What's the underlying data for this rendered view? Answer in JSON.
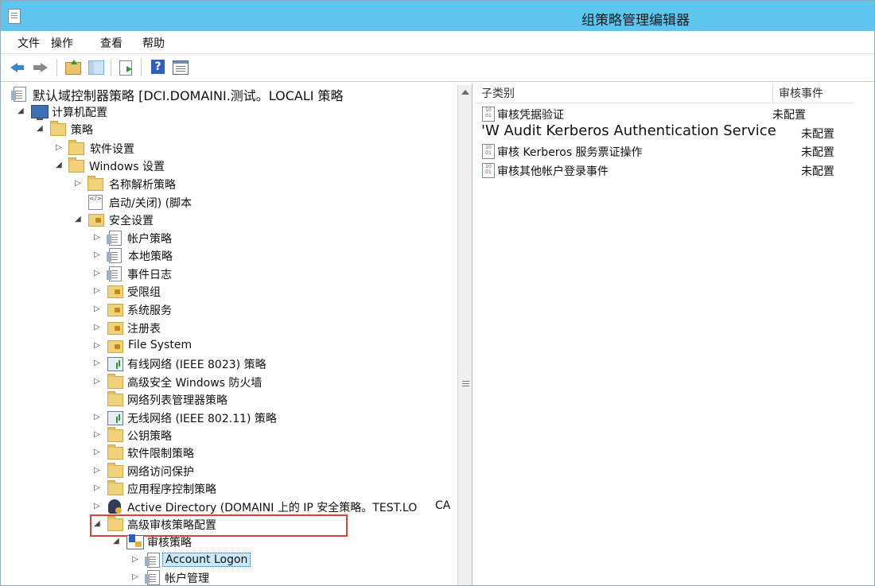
{
  "window": {
    "title": "组策略管理编辑器"
  },
  "menu": [
    "文件",
    "操作",
    "查看",
    "帮助"
  ],
  "toolbar": {
    "buttons": [
      "back-icon",
      "forward-icon",
      "up-folder-icon",
      "show-hide-tree-icon",
      "export-list-icon",
      "help-icon",
      "properties-icon"
    ]
  },
  "tree": {
    "root": "默认域控制器策略 [DCI.DOMAINI.测试。LOCALI 策略",
    "computer_config": "计算机配置",
    "policies": "策略",
    "software_settings": "软件设置",
    "windows_settings": "Windows 设置",
    "name_resolution": "名称解析策略",
    "scripts": "启动/关闭) (脚本",
    "security_settings": "安全设置",
    "account_policies": "帐户策略",
    "local_policies": "本地策略",
    "event_log": "事件日志",
    "restricted_groups": "受限组",
    "system_services": "系统服务",
    "registry": "注册表",
    "file_system": "File System",
    "wired_network": "有线网络 (IEEE 8023) 策略",
    "firewall": "高级安全 Windows 防火墙",
    "network_list": "网络列表管理器策略",
    "wireless_network": "无线网络 (IEEE 802.11) 策略",
    "public_key": "公钥策略",
    "software_restriction": "软件限制策略",
    "nap": "网络访问保护",
    "app_control": "应用程序控制策略",
    "ipsec": "Active Directory (DOMAINI 上的 IP 安全策略。TEST.LO",
    "ipsec_tail": "CA",
    "advanced_audit": "高级审核策略配置",
    "audit_policies": "审核策略",
    "account_logon": "Account Logon",
    "account_management": "帐户管理"
  },
  "list": {
    "headers": {
      "subcategory": "子类别",
      "audit_events": "审核事件"
    },
    "rows": [
      {
        "name": "审核凭据验证",
        "state": "未配置"
      },
      {
        "name": "'W Audit Kerberos Authentication Service",
        "state": "未配置"
      },
      {
        "name": "审核 Kerberos 服务票证操作",
        "state": "未配置"
      },
      {
        "name": "审核其他帐户登录事件",
        "state": "未配置"
      }
    ]
  },
  "colors": {
    "titlebar": "#5cc6ee",
    "highlight": "#e0403a",
    "selection": "#cbe8f6"
  }
}
